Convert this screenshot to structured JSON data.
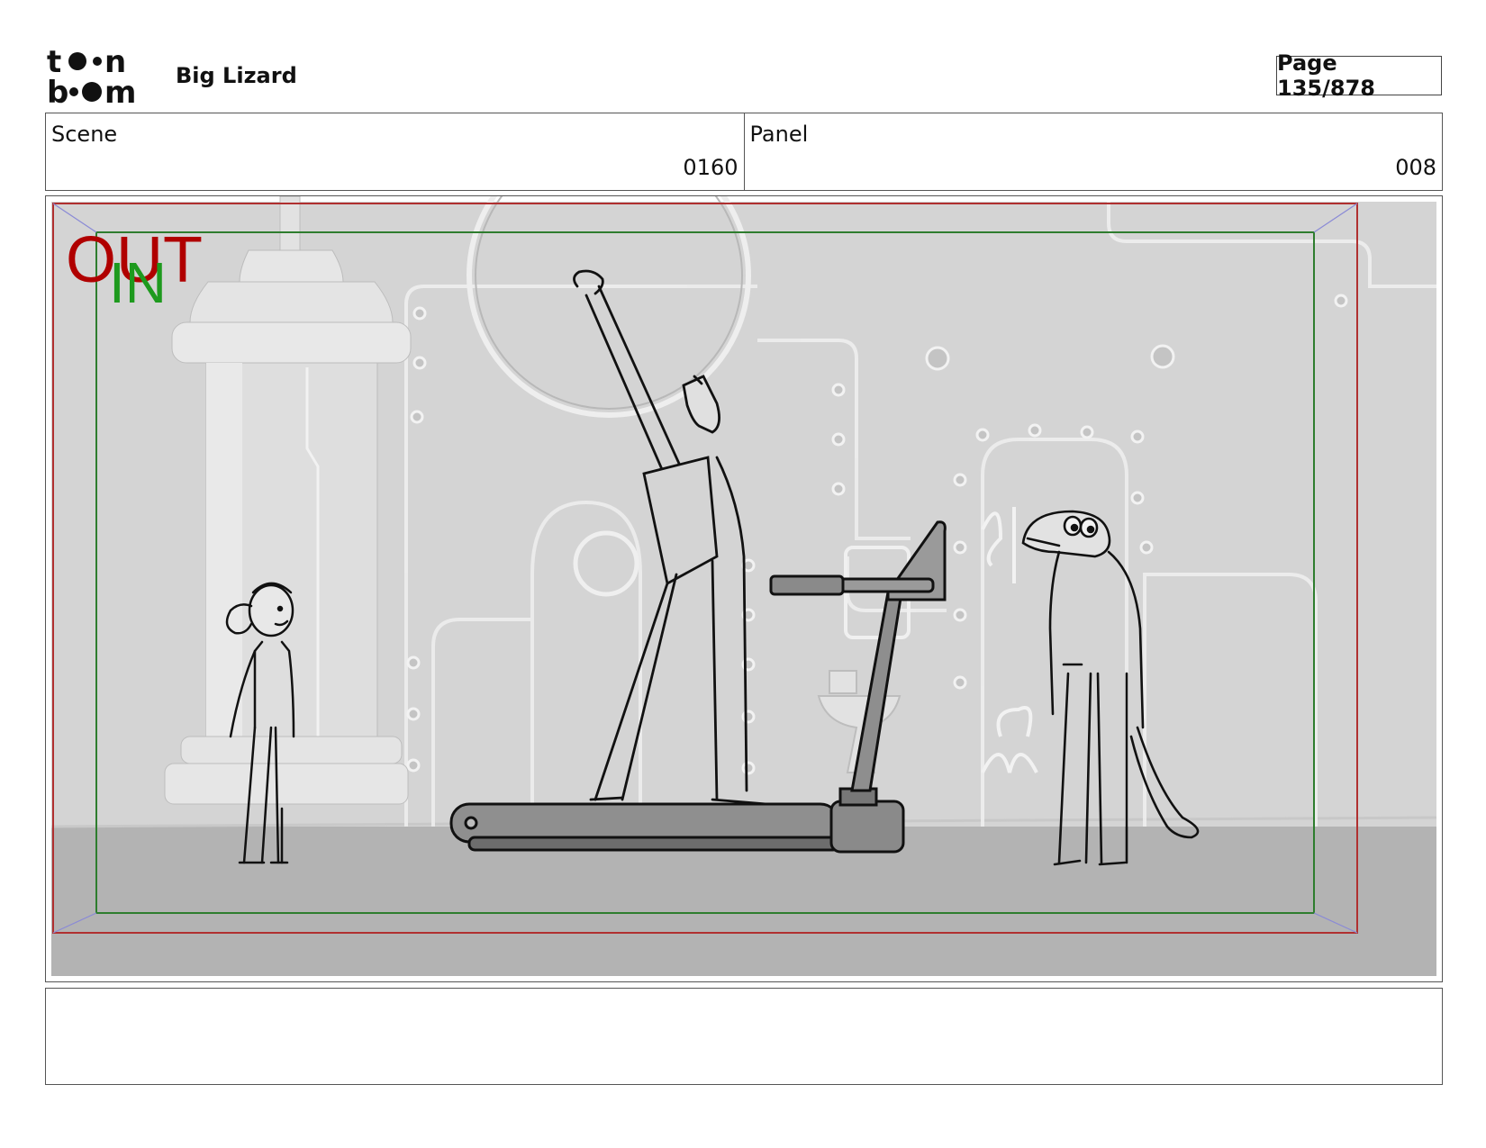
{
  "header": {
    "logo_text_top": "toon",
    "logo_text_bottom": "boom",
    "project_title": "Big Lizard",
    "page_label": "Page 135/878"
  },
  "info": {
    "scene_label": "Scene",
    "scene_value": "0160",
    "panel_label": "Panel",
    "panel_value": "008"
  },
  "panel": {
    "out_label": "OUT",
    "in_label": "IN",
    "out_color": "#b00000",
    "in_color": "#1e9a1e",
    "safe_frame_color": "#2e7d2e",
    "out_frame_color": "#b03030"
  },
  "notes": {
    "text": ""
  }
}
